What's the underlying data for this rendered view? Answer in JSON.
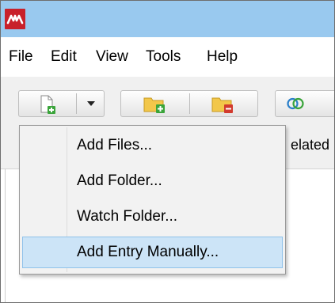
{
  "menu": [
    "File",
    "Edit",
    "View",
    "Tools",
    "Help"
  ],
  "toolbar": {
    "add_button_icon": "new-file-plus-icon",
    "dropdown_arrow_icon": "chevron-down-icon",
    "add_folder_icon": "folder-plus-icon",
    "remove_folder_icon": "folder-minus-icon",
    "related_icon": "overlapping-circles-icon",
    "partial_tab_label": "elated"
  },
  "dropdown": {
    "items": [
      "Add Files...",
      "Add Folder...",
      "Watch Folder...",
      "Add Entry Manually..."
    ],
    "selected_index": 3
  },
  "colors": {
    "titlebar": "#99c9ef",
    "logo": "#c8202a",
    "selection": "#cce4f7",
    "selection_border": "#90c2ea"
  }
}
